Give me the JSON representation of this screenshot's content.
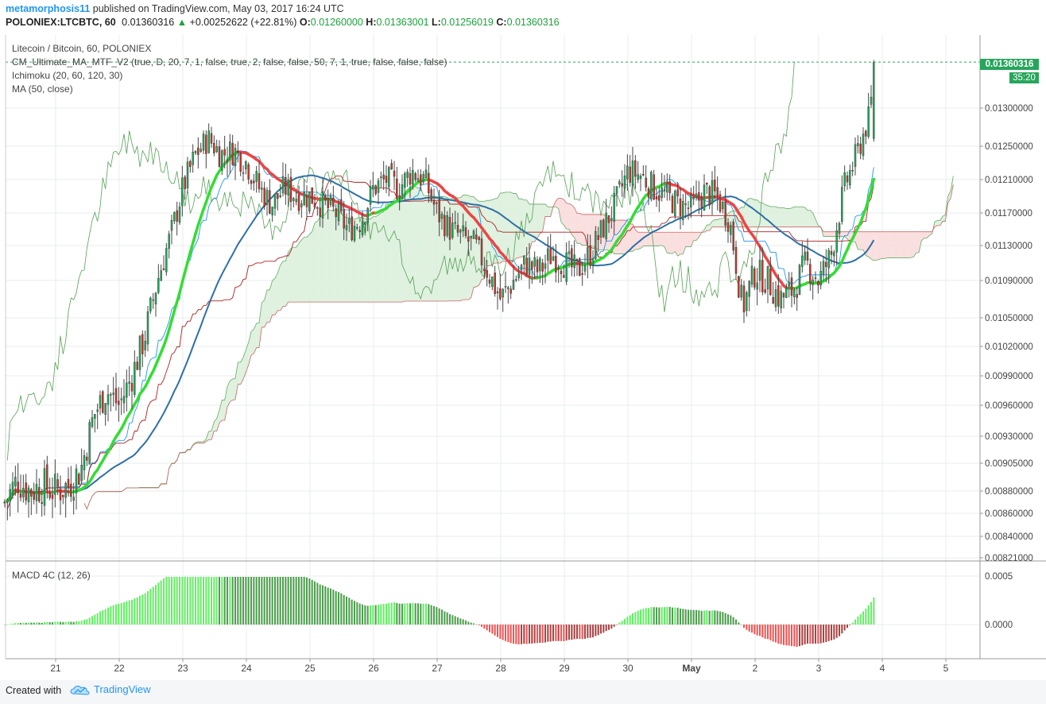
{
  "header": {
    "author": "metamorphosis11",
    "published_text": "published on TradingView.com, May 03, 2017 16:24 UTC",
    "symbol": "POLONIEX:LTCBTC, 60",
    "last": "0.01360316",
    "change": "+0.00252622 (+22.81%)",
    "o_label": "O:",
    "o_value": "0.01260000",
    "h_label": "H:",
    "h_value": "0.01363001",
    "l_label": "L:",
    "l_value": "0.01256019",
    "c_label": "C:",
    "c_value": "0.01360316"
  },
  "legend": {
    "title": "Litecoin / Bitcoin, 60, POLONIEX",
    "indicator1": "CM_Ultimate_MA_MTF_V2 (true, D, 20, 7, 1, false, true, 2, false, false, 50, 7, 1, true, false, false, false)",
    "indicator2": "Ichimoku (20, 60, 120, 30)",
    "indicator3": "MA (50, close)",
    "macd": "MACD 4C (12, 26)"
  },
  "price_tag": "0.01360316",
  "timer_tag": "35:20",
  "footer": {
    "created_with": "Created with",
    "brand": "TradingView"
  },
  "colors": {
    "bull": "#26a65b",
    "bear": "#c0392b",
    "ma_fast_up": "#33dd33",
    "ma_fast_down": "#ee4444",
    "ma50": "#2e6fa5",
    "cloud_green": "#d9efd9",
    "cloud_red": "#f9d9d9",
    "tenkan": "#2196f3",
    "kijun": "#aa2222",
    "chikou": "#55a055",
    "macd_light_green": "#66ee66",
    "macd_dark_green": "#4e9e4e",
    "macd_light_red": "#ee5555",
    "macd_dark_red": "#aa4444"
  },
  "chart_data": {
    "type": "candlestick",
    "x_ticks": [
      "21",
      "22",
      "23",
      "24",
      "25",
      "26",
      "27",
      "28",
      "29",
      "30",
      "May",
      "2",
      "3",
      "4",
      "5"
    ],
    "y_ticks": [
      "0.01300000",
      "0.01250000",
      "0.01210000",
      "0.01170000",
      "0.01130000",
      "0.01090000",
      "0.01050000",
      "0.01020000",
      "0.00990000",
      "0.00960000",
      "0.00930000",
      "0.00905000",
      "0.00880000",
      "0.00860000",
      "0.00840000",
      "0.00821000"
    ],
    "price_anchor_values": [
      0.013,
      0.0125,
      0.0121,
      0.0117,
      0.0113,
      0.0109,
      0.0105,
      0.0102,
      0.0099,
      0.0096,
      0.0093,
      0.00905,
      0.0088,
      0.0086,
      0.0084,
      0.00821
    ],
    "macd_ticks": [
      "0.0005",
      "0.0000"
    ],
    "close_path": [
      [
        20.0,
        0.00865
      ],
      [
        20.2,
        0.0087
      ],
      [
        20.4,
        0.0089
      ],
      [
        20.6,
        0.0088
      ],
      [
        20.8,
        0.00885
      ],
      [
        21.0,
        0.0088
      ],
      [
        21.2,
        0.00885
      ],
      [
        21.4,
        0.009
      ],
      [
        21.6,
        0.0095
      ],
      [
        21.8,
        0.00975
      ],
      [
        22.0,
        0.0096
      ],
      [
        22.2,
        0.0099
      ],
      [
        22.4,
        0.0103
      ],
      [
        22.6,
        0.0109
      ],
      [
        22.8,
        0.0114
      ],
      [
        23.0,
        0.012
      ],
      [
        23.2,
        0.0124
      ],
      [
        23.4,
        0.0126
      ],
      [
        23.6,
        0.0124
      ],
      [
        23.8,
        0.01245
      ],
      [
        24.0,
        0.0123
      ],
      [
        24.2,
        0.012
      ],
      [
        24.4,
        0.0118
      ],
      [
        24.6,
        0.012
      ],
      [
        24.8,
        0.0119
      ],
      [
        25.0,
        0.0119
      ],
      [
        25.2,
        0.0118
      ],
      [
        25.4,
        0.0117
      ],
      [
        25.6,
        0.0115
      ],
      [
        25.8,
        0.0116
      ],
      [
        26.0,
        0.012
      ],
      [
        26.2,
        0.0121
      ],
      [
        26.4,
        0.012
      ],
      [
        26.6,
        0.0122
      ],
      [
        26.8,
        0.0121
      ],
      [
        27.0,
        0.0117
      ],
      [
        27.2,
        0.0115
      ],
      [
        27.4,
        0.0114
      ],
      [
        27.6,
        0.0113
      ],
      [
        27.8,
        0.011
      ],
      [
        28.0,
        0.0107
      ],
      [
        28.2,
        0.0109
      ],
      [
        28.4,
        0.0111
      ],
      [
        28.6,
        0.011
      ],
      [
        28.8,
        0.0112
      ],
      [
        29.0,
        0.0111
      ],
      [
        29.2,
        0.011
      ],
      [
        29.4,
        0.0112
      ],
      [
        29.6,
        0.0115
      ],
      [
        29.8,
        0.0118
      ],
      [
        30.0,
        0.0122
      ],
      [
        30.2,
        0.01215
      ],
      [
        30.4,
        0.012
      ],
      [
        30.6,
        0.0119
      ],
      [
        30.8,
        0.0118
      ],
      [
        31.0,
        0.01175
      ],
      [
        31.2,
        0.01195
      ],
      [
        31.4,
        0.0119
      ],
      [
        31.6,
        0.0116
      ],
      [
        31.8,
        0.0106
      ],
      [
        32.0,
        0.011
      ],
      [
        32.2,
        0.0109
      ],
      [
        32.4,
        0.0107
      ],
      [
        32.6,
        0.0108
      ],
      [
        32.8,
        0.0111
      ],
      [
        33.0,
        0.0109
      ],
      [
        33.2,
        0.0112
      ],
      [
        33.4,
        0.012
      ],
      [
        33.6,
        0.0124
      ],
      [
        33.8,
        0.0129
      ],
      [
        33.9,
        0.01360316
      ]
    ]
  }
}
